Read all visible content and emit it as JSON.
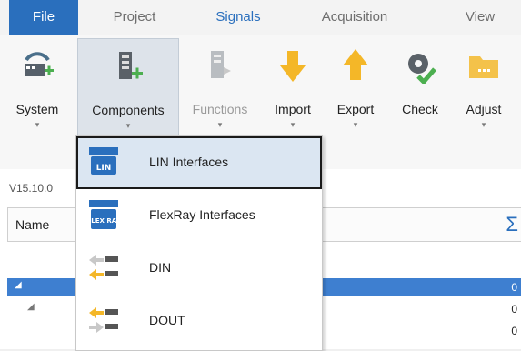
{
  "tabs": [
    {
      "label": "File"
    },
    {
      "label": "Project"
    },
    {
      "label": "Signals"
    },
    {
      "label": "Acquisition"
    },
    {
      "label": "View"
    }
  ],
  "ribbon": {
    "buttons": [
      {
        "label": "System",
        "icon": "system-add-icon",
        "dropdown": "▾"
      },
      {
        "label": "Components",
        "icon": "components-add-icon",
        "dropdown": "▾"
      },
      {
        "label": "Functions",
        "icon": "functions-icon",
        "dropdown": "▾"
      },
      {
        "label": "Import",
        "icon": "import-arrow-icon",
        "dropdown": "▾"
      },
      {
        "label": "Export",
        "icon": "export-arrow-icon",
        "dropdown": "▾"
      },
      {
        "label": "Check",
        "icon": "check-gear-icon",
        "dropdown": ""
      },
      {
        "label": "Adjust",
        "icon": "adjust-folder-icon",
        "dropdown": "▾"
      }
    ]
  },
  "panel": {
    "version": "V15.10.0",
    "column_name": "Name",
    "sigma": "Σ",
    "rows": [
      {
        "value": "0"
      },
      {
        "value": "0"
      },
      {
        "value": "0"
      }
    ]
  },
  "menu": {
    "items": [
      {
        "label": "LIN Interfaces",
        "icon_text": "LIN"
      },
      {
        "label": "FlexRay Interfaces",
        "icon_text": "FLEX RAY"
      },
      {
        "label": "DIN"
      },
      {
        "label": "DOUT"
      }
    ]
  },
  "colors": {
    "accent": "#2a6fbd",
    "highlight": "#dbe6f2",
    "selected_row": "#3e7fd0"
  }
}
